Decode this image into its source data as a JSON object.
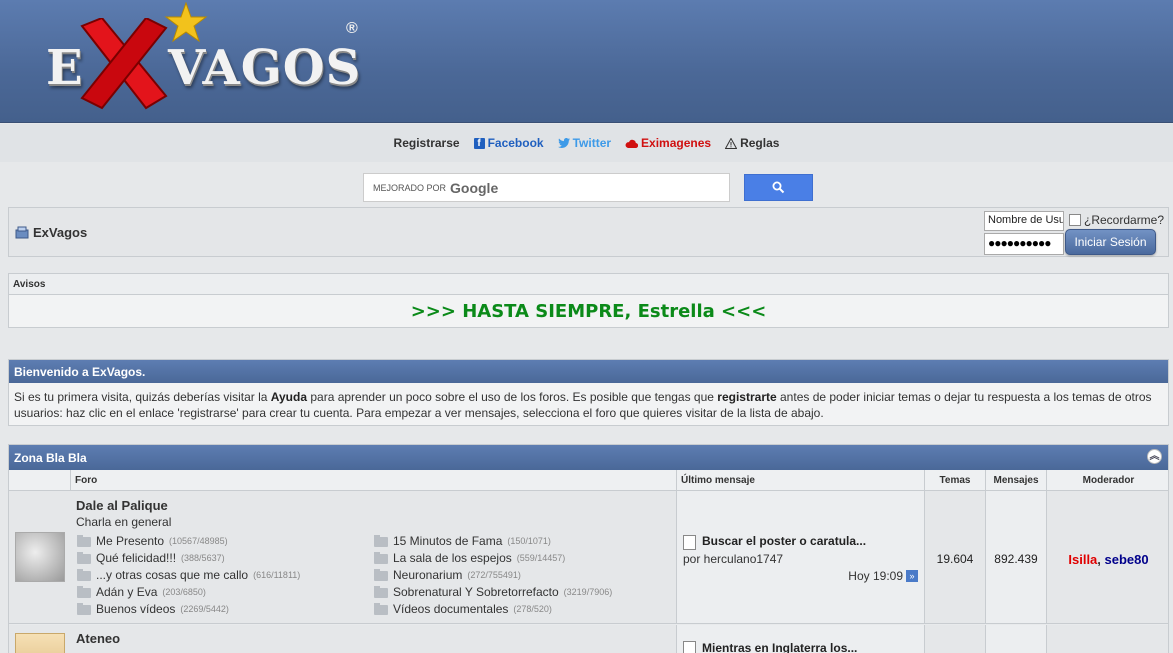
{
  "header": {
    "logo_e": "E",
    "logo_vagos": "VAGOS",
    "logo_reg": "®"
  },
  "nav": [
    {
      "label": "Registrarse"
    },
    {
      "label": "Facebook",
      "color": "#1f5fbf"
    },
    {
      "label": "Twitter",
      "color": "#3d9ae8"
    },
    {
      "label": "Eximagenes",
      "color": "#d01010"
    },
    {
      "label": "Reglas"
    }
  ],
  "search": {
    "prefix": "MEJORADO POR",
    "brand": "Google"
  },
  "crumb": {
    "title": "ExVagos"
  },
  "login": {
    "username_placeholder": "Nombre de Usu",
    "password_value": "●●●●●●●●●●",
    "remember_label": "¿Recordarme?",
    "submit_label": "Iniciar Sesión"
  },
  "avisos": {
    "heading": "Avisos",
    "message": ">>> HASTA SIEMPRE, Estrella <<<"
  },
  "welcome": {
    "heading": "Bienvenido a ExVagos.",
    "t1": "Si es tu primera visita, quizás deberías visitar la ",
    "b1": "Ayuda",
    "t2": " para aprender un poco sobre el uso de los foros. Es posible que tengas que ",
    "b2": "registrarte",
    "t3": " antes de poder iniciar temas o dejar tu respuesta a los temas de otros usuarios: haz clic en el enlace 'registrarse' para crear tu cuenta. Para empezar a ver mensajes, selecciona el foro que quieres visitar de la lista de abajo."
  },
  "zone": {
    "heading": "Zona Bla Bla",
    "columns": {
      "forum": "Foro",
      "last": "Último mensaje",
      "topics": "Temas",
      "posts": "Mensajes",
      "mod": "Moderador"
    },
    "forums": [
      {
        "title": "Dale al Palique",
        "desc": "Charla en general",
        "subs_left": [
          {
            "name": "Me Presento",
            "count": "(10567/48985)"
          },
          {
            "name": "Qué felicidad!!!",
            "count": "(388/5637)"
          },
          {
            "name": "...y otras cosas que me callo",
            "count": "(616/11811)"
          },
          {
            "name": "Adán y Eva",
            "count": "(203/6850)"
          },
          {
            "name": "Buenos vídeos",
            "count": "(2269/5442)"
          }
        ],
        "subs_right": [
          {
            "name": "15 Minutos de Fama",
            "count": "(150/1071)"
          },
          {
            "name": "La sala de los espejos",
            "count": "(559/14457)"
          },
          {
            "name": "Neuronarium",
            "count": "(272/755491)"
          },
          {
            "name": "Sobrenatural Y Sobretorrefacto",
            "count": "(3219/7906)"
          },
          {
            "name": "Vídeos documentales",
            "count": "(278/520)"
          }
        ],
        "last_title": "Buscar el poster o caratula...",
        "last_user": "por herculano1747",
        "last_time": "Hoy 19:09",
        "topics": "19.604",
        "posts": "892.439",
        "mod1": "Isilla",
        "sep": ", ",
        "mod2": "sebe80"
      },
      {
        "title": "Ateneo",
        "last_title": "Mientras en Inglaterra los..."
      }
    ]
  }
}
